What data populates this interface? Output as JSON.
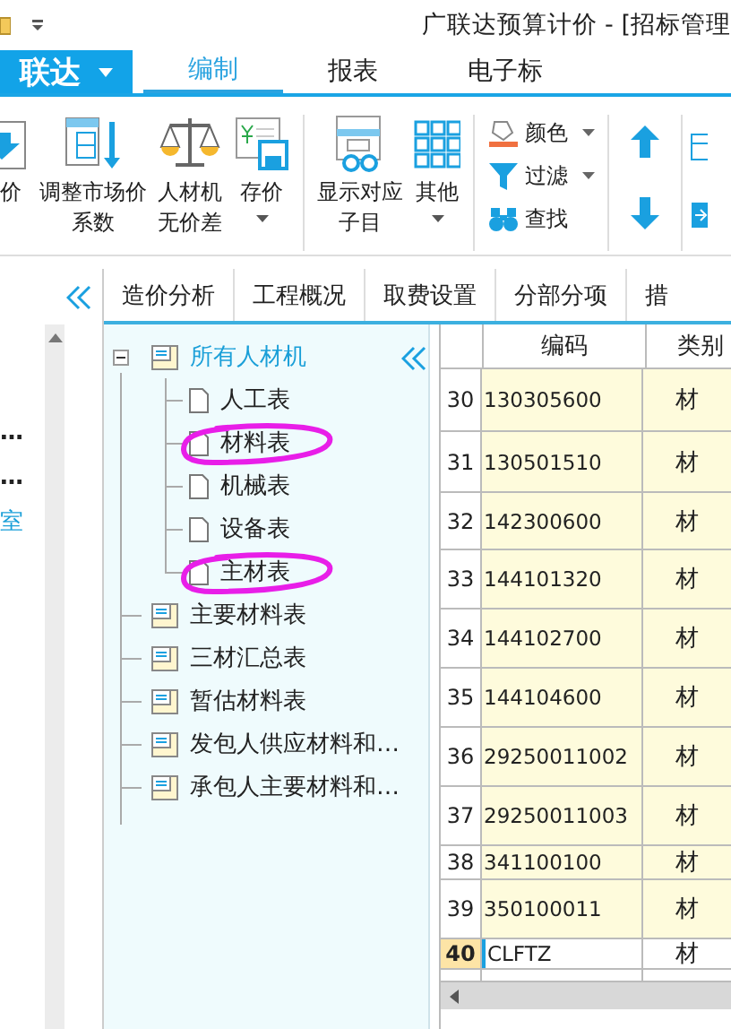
{
  "title_bar": {
    "title": "广联达预算计价 - [招标管理"
  },
  "app_menu": {
    "label": "联达"
  },
  "ribbon_tabs": [
    {
      "label": "编制",
      "selected": true
    },
    {
      "label": "报表",
      "selected": false
    },
    {
      "label": "电子标",
      "selected": false
    }
  ],
  "ribbon": [
    {
      "kind": "large",
      "label": "价",
      "dropdown": false
    },
    {
      "kind": "large",
      "lines": [
        "调整市场价",
        "系数"
      ],
      "dropdown": false
    },
    {
      "kind": "large",
      "lines": [
        "人材机",
        "无价差"
      ],
      "dropdown": false
    },
    {
      "kind": "large",
      "label": "存价",
      "dropdown": true
    },
    {
      "kind": "separator"
    },
    {
      "kind": "large",
      "lines": [
        "显示对应",
        "子目"
      ],
      "dropdown": false
    },
    {
      "kind": "large",
      "label": "其他",
      "dropdown": true
    },
    {
      "kind": "separator"
    },
    {
      "kind": "stack",
      "items": [
        {
          "label": "颜色",
          "dropdown": true
        },
        {
          "label": "过滤",
          "dropdown": true
        },
        {
          "label": "查找",
          "dropdown": false
        }
      ]
    },
    {
      "kind": "separator"
    },
    {
      "kind": "arrows"
    },
    {
      "kind": "separator"
    },
    {
      "kind": "edge"
    }
  ],
  "side_panel": {
    "items": [
      {
        "text": "…",
        "selected": false
      },
      {
        "text": "…",
        "selected": false
      },
      {
        "text": "室",
        "selected": true
      }
    ]
  },
  "view_tabs": [
    {
      "label": "造价分析",
      "selected": false
    },
    {
      "label": "工程概况",
      "selected": false
    },
    {
      "label": "取费设置",
      "selected": false
    },
    {
      "label": "分部分项",
      "selected": false
    },
    {
      "label": "措",
      "selected": false
    }
  ],
  "tree": [
    {
      "label": "所有人材机",
      "expanded": true,
      "selected": true,
      "children": [
        {
          "label": "人工表",
          "kind": "page",
          "circled": false
        },
        {
          "label": "材料表",
          "kind": "page",
          "circled": true
        },
        {
          "label": "机械表",
          "kind": "page",
          "circled": false
        },
        {
          "label": "设备表",
          "kind": "page",
          "circled": false
        },
        {
          "label": "主材表",
          "kind": "page",
          "circled": true
        }
      ]
    },
    {
      "label": "主要材料表",
      "selected": false
    },
    {
      "label": "三材汇总表",
      "selected": false
    },
    {
      "label": "暂估材料表",
      "selected": false
    },
    {
      "label": "发包人供应材料和…",
      "selected": false
    },
    {
      "label": "承包人主要材料和…",
      "selected": false
    }
  ],
  "table": {
    "columns": [
      "编码",
      "类别"
    ],
    "rows": [
      {
        "no": "30",
        "code": "130305600",
        "type": "材",
        "selected": false
      },
      {
        "no": "31",
        "code": "130501510",
        "type": "材",
        "selected": false
      },
      {
        "no": "32",
        "code": "142300600",
        "type": "材",
        "selected": false
      },
      {
        "no": "33",
        "code": "144101320",
        "type": "材",
        "selected": false
      },
      {
        "no": "34",
        "code": "144102700",
        "type": "材",
        "selected": false
      },
      {
        "no": "35",
        "code": "144104600",
        "type": "材",
        "selected": false
      },
      {
        "no": "36",
        "code": "29250011002",
        "type": "材",
        "selected": false
      },
      {
        "no": "37",
        "code": "29250011003",
        "type": "材",
        "selected": false
      },
      {
        "no": "38",
        "code": "341100100",
        "type": "材",
        "selected": false
      },
      {
        "no": "39",
        "code": "350100011",
        "type": "材",
        "selected": false
      },
      {
        "no": "40",
        "code": "CLFTZ",
        "type": "材",
        "selected": true
      }
    ]
  }
}
